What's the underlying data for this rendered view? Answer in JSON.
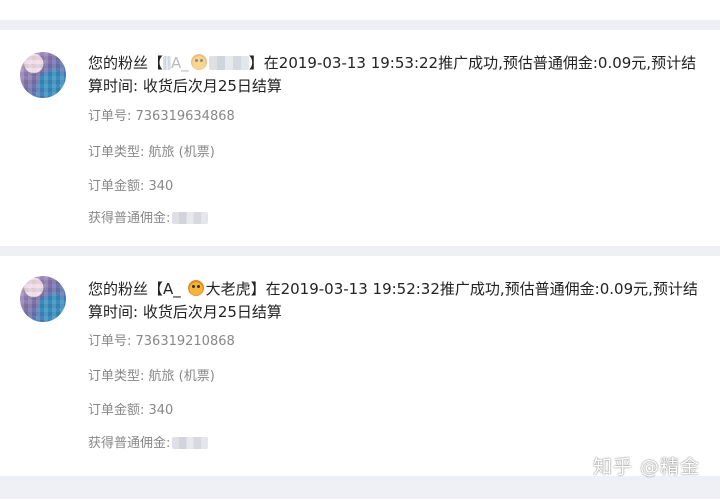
{
  "notifications": [
    {
      "msg_prefix": "您的粉丝【",
      "fan_name_visible": "A_",
      "msg_suffix": "】在2019-03-13 19:53:22推广成功,预估普通佣金:0.09元,预计结算时间: 收货后次月25日结算",
      "order_no_label": "订单号: 736319634868",
      "order_type_label": "订单类型: 航旅 (机票)",
      "order_amount_label": "订单金额: 340",
      "commission_label": "获得普通佣金:"
    },
    {
      "msg_prefix": "您的粉丝【",
      "fan_name_visible": "A_",
      "fan_name_tail": "大老虎",
      "msg_suffix": "】在2019-03-13 19:52:32推广成功,预估普通佣金:0.09元,预计结算时间: 收货后次月25日结算",
      "order_no_label": "订单号: 736319210868",
      "order_type_label": "订单类型: 航旅 (机票)",
      "order_amount_label": "订单金额: 340",
      "commission_label": "获得普通佣金:"
    }
  ],
  "watermark": "知乎 @精金",
  "colors": {
    "background": "#eef0f5",
    "card": "#ffffff",
    "primary_text": "#222222",
    "secondary_text": "#888888"
  },
  "icons": {
    "fan_emoji": "tiger-face-icon"
  }
}
